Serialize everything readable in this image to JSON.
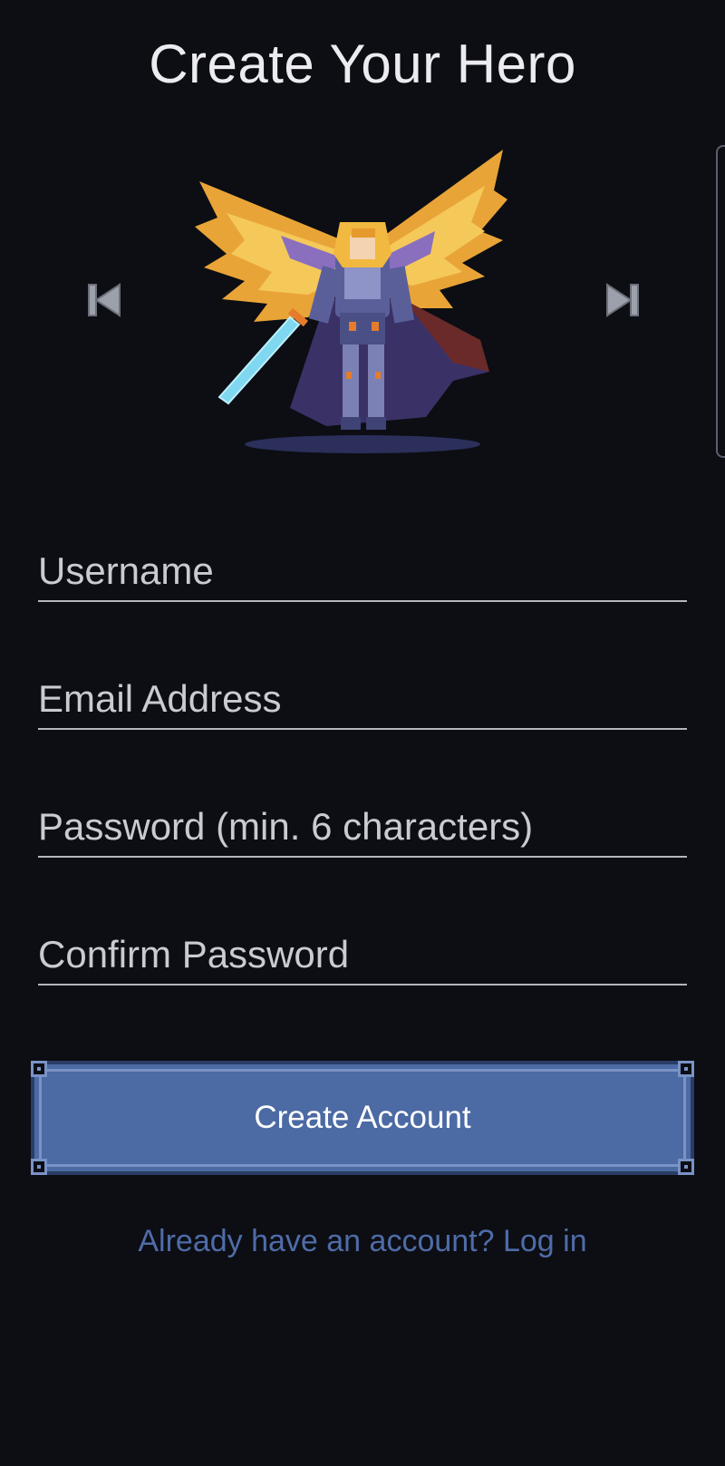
{
  "page": {
    "title": "Create Your Hero"
  },
  "hero_selector": {
    "prev_icon": "skip-previous-icon",
    "next_icon": "skip-next-icon",
    "sprite": "winged-knight-sprite"
  },
  "form": {
    "username": {
      "placeholder": "Username",
      "value": ""
    },
    "email": {
      "placeholder": "Email Address",
      "value": ""
    },
    "password": {
      "placeholder": "Password (min. 6 characters)",
      "value": ""
    },
    "confirm_password": {
      "placeholder": "Confirm Password",
      "value": ""
    }
  },
  "actions": {
    "create_account_label": "Create Account",
    "login_link_label": "Already have an account? Log in"
  },
  "colors": {
    "background": "#0c0e14",
    "accent": "#4c6aa3",
    "link": "#4f6ca8",
    "text": "#ececf0"
  }
}
